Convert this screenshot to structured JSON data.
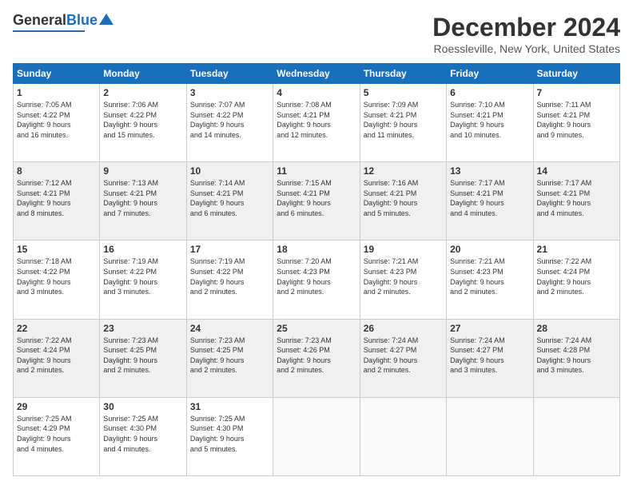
{
  "logo": {
    "general": "General",
    "blue": "Blue"
  },
  "header": {
    "title": "December 2024",
    "location": "Roessleville, New York, United States"
  },
  "weekdays": [
    "Sunday",
    "Monday",
    "Tuesday",
    "Wednesday",
    "Thursday",
    "Friday",
    "Saturday"
  ],
  "weeks": [
    [
      {
        "day": "1",
        "info": "Sunrise: 7:05 AM\nSunset: 4:22 PM\nDaylight: 9 hours\nand 16 minutes."
      },
      {
        "day": "2",
        "info": "Sunrise: 7:06 AM\nSunset: 4:22 PM\nDaylight: 9 hours\nand 15 minutes."
      },
      {
        "day": "3",
        "info": "Sunrise: 7:07 AM\nSunset: 4:22 PM\nDaylight: 9 hours\nand 14 minutes."
      },
      {
        "day": "4",
        "info": "Sunrise: 7:08 AM\nSunset: 4:21 PM\nDaylight: 9 hours\nand 12 minutes."
      },
      {
        "day": "5",
        "info": "Sunrise: 7:09 AM\nSunset: 4:21 PM\nDaylight: 9 hours\nand 11 minutes."
      },
      {
        "day": "6",
        "info": "Sunrise: 7:10 AM\nSunset: 4:21 PM\nDaylight: 9 hours\nand 10 minutes."
      },
      {
        "day": "7",
        "info": "Sunrise: 7:11 AM\nSunset: 4:21 PM\nDaylight: 9 hours\nand 9 minutes."
      }
    ],
    [
      {
        "day": "8",
        "info": "Sunrise: 7:12 AM\nSunset: 4:21 PM\nDaylight: 9 hours\nand 8 minutes."
      },
      {
        "day": "9",
        "info": "Sunrise: 7:13 AM\nSunset: 4:21 PM\nDaylight: 9 hours\nand 7 minutes."
      },
      {
        "day": "10",
        "info": "Sunrise: 7:14 AM\nSunset: 4:21 PM\nDaylight: 9 hours\nand 6 minutes."
      },
      {
        "day": "11",
        "info": "Sunrise: 7:15 AM\nSunset: 4:21 PM\nDaylight: 9 hours\nand 6 minutes."
      },
      {
        "day": "12",
        "info": "Sunrise: 7:16 AM\nSunset: 4:21 PM\nDaylight: 9 hours\nand 5 minutes."
      },
      {
        "day": "13",
        "info": "Sunrise: 7:17 AM\nSunset: 4:21 PM\nDaylight: 9 hours\nand 4 minutes."
      },
      {
        "day": "14",
        "info": "Sunrise: 7:17 AM\nSunset: 4:21 PM\nDaylight: 9 hours\nand 4 minutes."
      }
    ],
    [
      {
        "day": "15",
        "info": "Sunrise: 7:18 AM\nSunset: 4:22 PM\nDaylight: 9 hours\nand 3 minutes."
      },
      {
        "day": "16",
        "info": "Sunrise: 7:19 AM\nSunset: 4:22 PM\nDaylight: 9 hours\nand 3 minutes."
      },
      {
        "day": "17",
        "info": "Sunrise: 7:19 AM\nSunset: 4:22 PM\nDaylight: 9 hours\nand 2 minutes."
      },
      {
        "day": "18",
        "info": "Sunrise: 7:20 AM\nSunset: 4:23 PM\nDaylight: 9 hours\nand 2 minutes."
      },
      {
        "day": "19",
        "info": "Sunrise: 7:21 AM\nSunset: 4:23 PM\nDaylight: 9 hours\nand 2 minutes."
      },
      {
        "day": "20",
        "info": "Sunrise: 7:21 AM\nSunset: 4:23 PM\nDaylight: 9 hours\nand 2 minutes."
      },
      {
        "day": "21",
        "info": "Sunrise: 7:22 AM\nSunset: 4:24 PM\nDaylight: 9 hours\nand 2 minutes."
      }
    ],
    [
      {
        "day": "22",
        "info": "Sunrise: 7:22 AM\nSunset: 4:24 PM\nDaylight: 9 hours\nand 2 minutes."
      },
      {
        "day": "23",
        "info": "Sunrise: 7:23 AM\nSunset: 4:25 PM\nDaylight: 9 hours\nand 2 minutes."
      },
      {
        "day": "24",
        "info": "Sunrise: 7:23 AM\nSunset: 4:25 PM\nDaylight: 9 hours\nand 2 minutes."
      },
      {
        "day": "25",
        "info": "Sunrise: 7:23 AM\nSunset: 4:26 PM\nDaylight: 9 hours\nand 2 minutes."
      },
      {
        "day": "26",
        "info": "Sunrise: 7:24 AM\nSunset: 4:27 PM\nDaylight: 9 hours\nand 2 minutes."
      },
      {
        "day": "27",
        "info": "Sunrise: 7:24 AM\nSunset: 4:27 PM\nDaylight: 9 hours\nand 3 minutes."
      },
      {
        "day": "28",
        "info": "Sunrise: 7:24 AM\nSunset: 4:28 PM\nDaylight: 9 hours\nand 3 minutes."
      }
    ],
    [
      {
        "day": "29",
        "info": "Sunrise: 7:25 AM\nSunset: 4:29 PM\nDaylight: 9 hours\nand 4 minutes."
      },
      {
        "day": "30",
        "info": "Sunrise: 7:25 AM\nSunset: 4:30 PM\nDaylight: 9 hours\nand 4 minutes."
      },
      {
        "day": "31",
        "info": "Sunrise: 7:25 AM\nSunset: 4:30 PM\nDaylight: 9 hours\nand 5 minutes."
      },
      {
        "day": "",
        "info": ""
      },
      {
        "day": "",
        "info": ""
      },
      {
        "day": "",
        "info": ""
      },
      {
        "day": "",
        "info": ""
      }
    ]
  ]
}
